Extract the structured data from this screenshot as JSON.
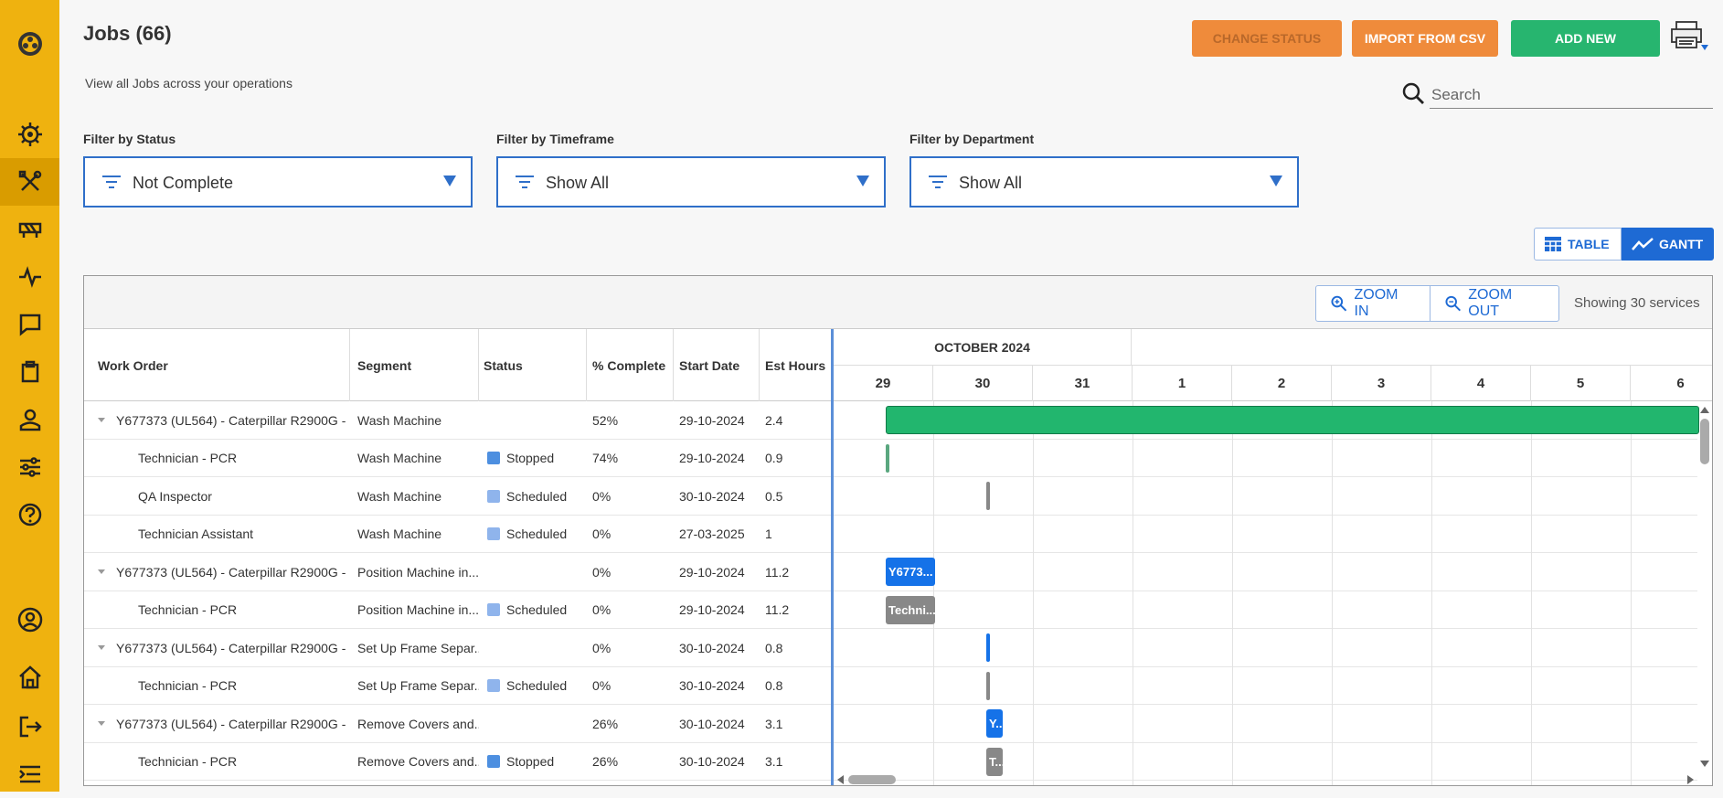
{
  "page": {
    "title": "Jobs (66)",
    "subtitle": "View all Jobs across your operations"
  },
  "sidebar": {
    "items": [
      "logo-icon",
      "dashboard-icon",
      "jobs-icon",
      "assets-icon",
      "activity-icon",
      "messages-icon",
      "checklists-icon",
      "users-icon",
      "settings-sliders-icon",
      "help-icon",
      "profile-icon",
      "home-icon",
      "logout-icon",
      "collapse-menu-icon"
    ],
    "active": "jobs-icon",
    "accent": "#efb20f"
  },
  "toolbar": {
    "change_status": "CHANGE STATUS",
    "import_csv": "IMPORT FROM CSV",
    "add_new": "ADD NEW",
    "search_placeholder": "Search"
  },
  "filters": [
    {
      "label": "Filter by Status",
      "value": "Not Complete"
    },
    {
      "label": "Filter by Timeframe",
      "value": "Show All"
    },
    {
      "label": "Filter by Department",
      "value": "Show All"
    }
  ],
  "view_toggle": {
    "table": "TABLE",
    "gantt": "GANTT",
    "active": "GANTT"
  },
  "grid": {
    "zoom_in": "ZOOM IN",
    "zoom_out": "ZOOM OUT",
    "showing": "Showing 30 services",
    "columns": [
      "Work Order",
      "Segment",
      "Status",
      "% Complete",
      "Start Date",
      "Est Hours"
    ],
    "month": "OCTOBER 2024",
    "days": [
      "29",
      "30",
      "31",
      "1",
      "2",
      "3",
      "4",
      "5",
      "6"
    ],
    "rows": [
      {
        "parent": true,
        "work_order": "Y677373 (UL564) - Caterpillar R2900G - ...",
        "segment": "Wash Machine",
        "status": "",
        "pct": "52%",
        "start": "29-10-2024",
        "hours": "2.4"
      },
      {
        "parent": false,
        "work_order": "Technician - PCR",
        "segment": "Wash Machine",
        "status": "Stopped",
        "pct": "74%",
        "start": "29-10-2024",
        "hours": "0.9"
      },
      {
        "parent": false,
        "work_order": "QA Inspector",
        "segment": "Wash Machine",
        "status": "Scheduled",
        "pct": "0%",
        "start": "30-10-2024",
        "hours": "0.5"
      },
      {
        "parent": false,
        "work_order": "Technician Assistant",
        "segment": "Wash Machine",
        "status": "Scheduled",
        "pct": "0%",
        "start": "27-03-2025",
        "hours": "1"
      },
      {
        "parent": true,
        "work_order": "Y677373 (UL564) - Caterpillar R2900G - ...",
        "segment": "Position Machine in...",
        "status": "",
        "pct": "0%",
        "start": "29-10-2024",
        "hours": "11.2"
      },
      {
        "parent": false,
        "work_order": "Technician - PCR",
        "segment": "Position Machine in...",
        "status": "Scheduled",
        "pct": "0%",
        "start": "29-10-2024",
        "hours": "11.2"
      },
      {
        "parent": true,
        "work_order": "Y677373 (UL564) - Caterpillar R2900G - ...",
        "segment": "Set Up Frame Separ...",
        "status": "",
        "pct": "0%",
        "start": "30-10-2024",
        "hours": "0.8"
      },
      {
        "parent": false,
        "work_order": "Technician - PCR",
        "segment": "Set Up Frame Separ...",
        "status": "Scheduled",
        "pct": "0%",
        "start": "30-10-2024",
        "hours": "0.8"
      },
      {
        "parent": true,
        "work_order": "Y677373 (UL564) - Caterpillar R2900G - ...",
        "segment": "Remove Covers and...",
        "status": "",
        "pct": "26%",
        "start": "30-10-2024",
        "hours": "3.1"
      },
      {
        "parent": false,
        "work_order": "Technician - PCR",
        "segment": "Remove Covers and...",
        "status": "Stopped",
        "pct": "26%",
        "start": "30-10-2024",
        "hours": "3.1"
      }
    ],
    "bars": [
      {
        "row": 0,
        "label": "",
        "color": "#22b66e"
      },
      {
        "row": 1,
        "label": "",
        "color": "#5aa77f"
      },
      {
        "row": 2,
        "label": "",
        "color": "#888888"
      },
      {
        "row": 4,
        "label": "Y6773...",
        "color": "#1572e8"
      },
      {
        "row": 5,
        "label": "Techni...",
        "color": "#888888"
      },
      {
        "row": 6,
        "label": "",
        "color": "#1572e8"
      },
      {
        "row": 7,
        "label": "",
        "color": "#888888"
      },
      {
        "row": 8,
        "label": "Y...",
        "color": "#1572e8"
      },
      {
        "row": 9,
        "label": "T...",
        "color": "#888888"
      }
    ]
  }
}
